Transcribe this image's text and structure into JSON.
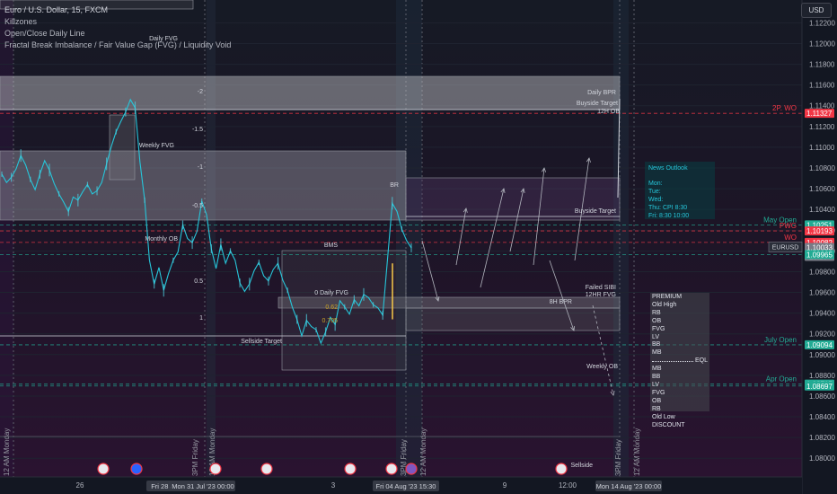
{
  "header": {
    "title": "Euro / U.S. Dollar, 15, FXCM",
    "indicators": [
      "Killzones",
      "Open/Close Daily Line",
      "Fractal Break Imbalance / Fair Value Gap (FVG) / Liquidity Void"
    ],
    "currency_button": "USD"
  },
  "news_outlook": {
    "title": "News Outlook",
    "lines": [
      "Mon:",
      "Tue:",
      "Wed:",
      "Thu:  CPI 8:30",
      "Fri:  8:30 10:00"
    ]
  },
  "pd_panel": {
    "premium": [
      "PREMIUM",
      "Old High",
      "RB",
      "OB",
      "FVG",
      "LV",
      "BB",
      "MB"
    ],
    "eql": "EQL",
    "discount": [
      "MB",
      "BB",
      "LV",
      "FVG",
      "OB",
      "RB",
      "Old Low",
      "DISCOUNT"
    ]
  },
  "chart_data": {
    "type": "line",
    "symbol": "EURUSD",
    "timeframe": "15",
    "ylim": [
      1.0782,
      1.1242
    ],
    "price_ticks": [
      "1.12200",
      "1.12000",
      "1.11800",
      "1.11600",
      "1.11400",
      "1.11200",
      "1.11000",
      "1.10800",
      "1.10600",
      "1.10400",
      "1.10200",
      "1.10000",
      "1.09800",
      "1.09600",
      "1.09400",
      "1.09200",
      "1.09000",
      "1.08800",
      "1.08600",
      "1.08400",
      "1.08200",
      "1.08000"
    ],
    "price_badges": [
      {
        "value": "1.11327",
        "color": "#f23645"
      },
      {
        "value": "1.10251",
        "color": "#22ab94"
      },
      {
        "value": "1.10193",
        "color": "#f23645"
      },
      {
        "value": "1.10082",
        "color": "#f23645"
      },
      {
        "value": "1.10033",
        "color": "#787b86",
        "extra": "13:10",
        "tag": "EURUSD"
      },
      {
        "value": "1.09965",
        "color": "#22ab94"
      },
      {
        "value": "1.09094",
        "color": "#22ab94"
      },
      {
        "value": "1.08715",
        "color": "#22ab94"
      },
      {
        "value": "1.08697",
        "color": "#22ab94"
      }
    ],
    "time_labels": [
      "26",
      "3",
      "9",
      "12:00",
      "Fri 28 Jul '23  10:00",
      "Mon 31 Jul '23  00:00",
      "Fri 04 Aug '23  15:30",
      "Mon 14 Aug '23  00:00",
      "12 AM Monday",
      "3PM Friday",
      "12 AM Monday",
      "3PM Friday",
      "12 AM Monday",
      "3PM Friday",
      "12 AM Monday"
    ],
    "level_lines": [
      {
        "label": "2P. WO",
        "price": 1.11327,
        "color": "#f23645",
        "style": "dash"
      },
      {
        "label": "May Open",
        "price": 1.10251,
        "color": "#22ab94",
        "style": "dash"
      },
      {
        "label": "PWG",
        "price": 1.10193,
        "color": "#f23645",
        "style": "dash"
      },
      {
        "label": "WO",
        "price": 1.10082,
        "color": "#f23645",
        "style": "dash"
      },
      {
        "label": "A",
        "price": 1.09965,
        "color": "#22ab94",
        "style": "dash"
      },
      {
        "label": "July Open",
        "price": 1.09094,
        "color": "#22ab94",
        "style": "dash"
      },
      {
        "label": "Apr Open",
        "price": 1.08715,
        "color": "#22ab94",
        "style": "dash"
      },
      {
        "label": "",
        "price": 1.08697,
        "color": "#22ab94",
        "style": "dash"
      }
    ],
    "annotations": [
      "Daily FVG",
      "Daily BPR",
      "Buyside Target",
      "12H OB",
      "Weekly FVG",
      "BR",
      "Buyside Target",
      "Monthly OB",
      "BMS",
      "0 Daily FVG",
      "Sellside Target",
      "Failed SIBI",
      "12HR FVG",
      "8H BPR",
      "Weekly OB",
      "Sellside",
      "-2",
      "-1.5",
      "-1",
      "-0.5",
      "0.5",
      "1",
      "0.62",
      "0.705"
    ],
    "series": [
      {
        "name": "EURUSD",
        "values": [
          1.1074,
          1.1066,
          1.1071,
          1.1079,
          1.1092,
          1.1083,
          1.1069,
          1.1059,
          1.1074,
          1.1087,
          1.1078,
          1.1065,
          1.1055,
          1.1047,
          1.1038,
          1.1052,
          1.1049,
          1.1057,
          1.1064,
          1.1055,
          1.1058,
          1.1066,
          1.1084,
          1.1101,
          1.1115,
          1.1125,
          1.1134,
          1.1146,
          1.1138,
          1.1086,
          1.1049,
          1.0991,
          1.0968,
          1.0984,
          1.0962,
          1.0978,
          1.0991,
          1.0999,
          1.1025,
          1.1012,
          1.1008,
          1.1019,
          1.1048,
          1.1035,
          1.1002,
          1.0983,
          1.1006,
          1.0988,
          1.1,
          1.0991,
          1.0969,
          1.0961,
          1.0968,
          1.0981,
          1.0989,
          1.0976,
          1.0971,
          1.0982,
          1.0988,
          1.0972,
          1.0962,
          1.0946,
          1.0934,
          1.0918,
          1.0933,
          1.0927,
          1.0924,
          1.0911,
          1.0922,
          1.0936,
          1.0929,
          1.0952,
          1.0946,
          1.0939,
          1.0953,
          1.0947,
          1.0958,
          1.0955,
          1.0948,
          1.0945,
          1.0938,
          1.0992,
          1.1046,
          1.1038,
          1.1021,
          1.101,
          1.1003
        ]
      }
    ]
  }
}
